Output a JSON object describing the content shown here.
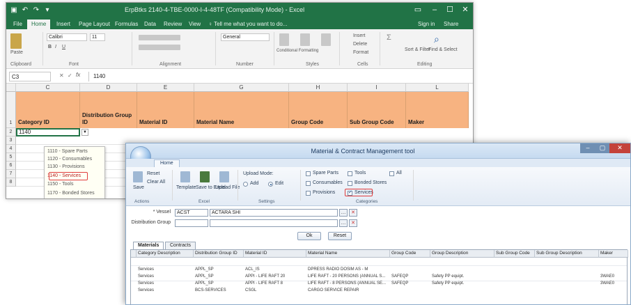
{
  "excel": {
    "title": "ErpBtks 2140-4-TBE-0000-I-4-48TF (Compatibility Mode) - Excel",
    "tabs": [
      "File",
      "Home",
      "Insert",
      "Page Layout",
      "Formulas",
      "Data",
      "Review",
      "View",
      "♀ Tell me what you want to do..."
    ],
    "user": "Sign in",
    "share": "Share",
    "font": {
      "name": "Calibri",
      "size": "11"
    },
    "number_format": "General",
    "ribbon_groups": [
      "Clipboard",
      "Font",
      "Alignment",
      "Number",
      "Styles",
      "Cells",
      "Editing"
    ],
    "name_box": "C3",
    "formula": "1140",
    "columns": [
      "C",
      "D",
      "E",
      "F",
      "G",
      "H",
      "I",
      "L"
    ],
    "rows": [
      "1",
      "2",
      "3",
      "4",
      "5",
      "6",
      "7",
      "8"
    ],
    "headers": [
      "Category ID",
      "Distribution Group ID",
      "Material ID",
      "Material Name",
      "Group Code",
      "Sub Group Code",
      "Maker"
    ],
    "active_value": "1140",
    "dropdown_items": [
      "1110 - Spare Parts",
      "1120 - Consumables",
      "1130 - Provisions",
      "1140 - Services",
      "1150 - Tools",
      "1170 - Bonded Stores"
    ],
    "highlighted_item": "1140 - Services",
    "styles_labels": [
      "Conditional Formatting",
      "Format as Table",
      "Cell Styles"
    ],
    "cells_labels": [
      "Insert",
      "Delete",
      "Format"
    ],
    "editing_labels": [
      "Sort & Filter",
      "Find & Select"
    ]
  },
  "mcm": {
    "title": "Material & Contract Management tool",
    "tab": "Home",
    "buttons": [
      "Save",
      "Reset",
      "Clear All",
      "Template",
      "Save to Excel",
      "Upload File"
    ],
    "upload_mode": {
      "label": "Upload Mode:",
      "options": [
        "Add",
        "Edit"
      ],
      "selected": "Edit"
    },
    "checkboxes": [
      {
        "label": "Spare Parts",
        "checked": false
      },
      {
        "label": "Tools",
        "checked": false
      },
      {
        "label": "All",
        "checked": false
      },
      {
        "label": "Consumables",
        "checked": false
      },
      {
        "label": "Bonded Stores",
        "checked": false
      },
      {
        "label": "Provisions",
        "checked": false
      },
      {
        "label": "Services",
        "checked": true
      }
    ],
    "ribbon_groups": [
      "Actions",
      "Excel",
      "Settings",
      "Categories"
    ],
    "vessel_label": "* Vessel",
    "vessel_code": "ACST",
    "vessel_name": "ACTARA SHI",
    "distribution_group_label": "Distribution Group",
    "ok": "Ok",
    "reset": "Reset",
    "data_tabs": [
      "Materials",
      "Contracts"
    ],
    "table_headers": [
      "Category Description",
      "Distribution Group ID",
      "Material ID",
      "Material Name",
      "Group Code",
      "Group Description",
      "Sub Group Code",
      "Sub Group Description",
      "Maker"
    ],
    "rows": [
      [
        "Services",
        "APPL_SP",
        "ACL_IS",
        "DPRESS RADIO DOSIM AS - M",
        "",
        "",
        "",
        "",
        ""
      ],
      [
        "Services",
        "APPL_SP",
        "APPI - LIFE RAFT 20",
        "LIFE RAFT - 20 PERSONS (ANNUAL S...",
        "SAFEQP",
        "Safety PP equipt.",
        "",
        "",
        "3WAE0"
      ],
      [
        "Services",
        "APPL_SP",
        "APPI - LIFE RAFT 8",
        "LIFE RAFT - 8 PERSONS (ANNUAL SE...",
        "SAFEQP",
        "Safety PP equipt.",
        "",
        "",
        "3WAE0"
      ],
      [
        "Services",
        "BCS-SERVICES",
        "CSGL",
        "CARGO SERVICE REPAIR",
        "",
        "",
        "",
        "",
        ""
      ]
    ]
  }
}
